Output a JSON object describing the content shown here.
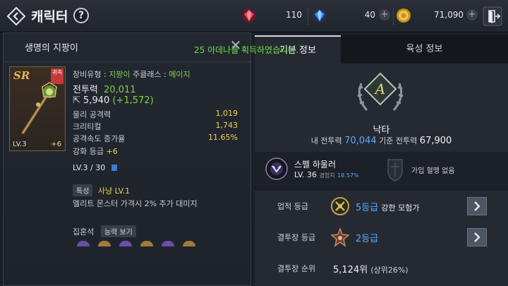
{
  "header": {
    "title": "캐릭터",
    "help_label": "?",
    "currencies": [
      {
        "icon": "red-gem-icon",
        "value": "110"
      },
      {
        "icon": "blue-gem-icon",
        "value": "40"
      },
      {
        "icon": "gold-coin-icon",
        "value": "71,090"
      }
    ],
    "plus_label": "+"
  },
  "toast": "25 아데나를 획득하였습니다.",
  "item": {
    "panel_title": "생명의 지팡이",
    "grade": "SR",
    "corner_tag": "귀속",
    "card_level": "LV.3",
    "card_plus": "+6",
    "equip_type_label": "장비유형 :",
    "equip_type_value": "지팡이",
    "class_label": "주클래스 :",
    "class_value": "메이지",
    "combat_label": "전투력",
    "combat_value": "20,011",
    "delta_value": "5,940",
    "delta_change": "(+1,572)",
    "stats": [
      {
        "label": "물리 공격력",
        "value": "1,019"
      },
      {
        "label": "크리티컬",
        "value": "1,743"
      },
      {
        "label": "공격속도 증가율",
        "value": "11.65%"
      }
    ],
    "enhance_label": "강화 등급",
    "enhance_value": "+6",
    "level_text": "LV.3 / 30",
    "trait_tag": "특성",
    "trait_value": "사냥 LV.1",
    "trait_desc": "엘리트 몬스터 가격시 2% 추가 대미지",
    "rune_label": "집혼석",
    "rune_button": "능력 보기"
  },
  "tabs": [
    {
      "label": "기본 정보"
    },
    {
      "label": "육성 정보"
    }
  ],
  "profile": {
    "grade_letter": "A",
    "name": "낙타",
    "my_power_label": "내 전투력",
    "my_power_value": "70,044",
    "base_power_label": "기준 전투력",
    "base_power_value": "67,900"
  },
  "guild": {
    "name": "스펠 하울러",
    "level": "LV. 36",
    "exp_label": "경험치",
    "exp_value": "18.57%",
    "blood_text": "가입 혈맹 없음"
  },
  "achievements": {
    "label": "업적 등급",
    "value": "5등급",
    "sub": "강한 모험가"
  },
  "arena": {
    "label": "결투장 등급",
    "value": "2등급"
  },
  "ranking": {
    "label": "결투장 순위",
    "value": "5,124위",
    "sub": "(상위26%)"
  },
  "colors": {
    "accent_blue": "#5aa9ff",
    "green": "#7fd04b",
    "yellow": "#f4d34d"
  }
}
